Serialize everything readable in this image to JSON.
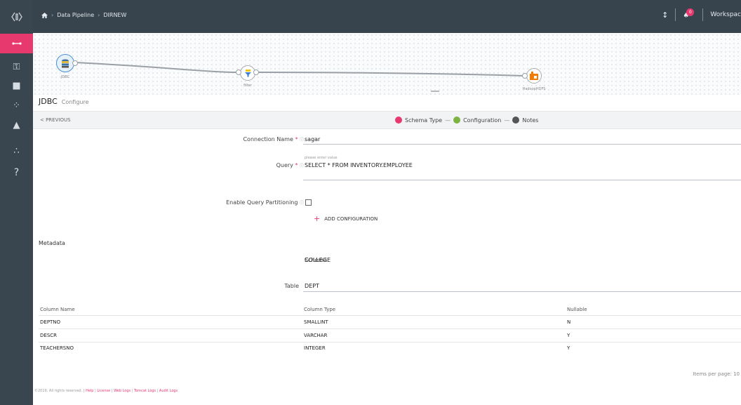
{
  "colors": {
    "accent": "#e8396f",
    "topbar": "#37444e",
    "rail": "#394650",
    "step_green": "#7cb342",
    "step_grey": "#555555",
    "hdfs_orange": "#f57c00"
  },
  "header": {
    "breadcrumb": [
      "Data Pipeline",
      "DIRNEW"
    ],
    "workspace_label": "Workspac",
    "notification_count": "0"
  },
  "pipeline": {
    "nodes": [
      {
        "label": "JDBC",
        "icon": "database-icon"
      },
      {
        "label": "filter",
        "icon": "filter-icon"
      },
      {
        "label": "HadoopHDFS",
        "icon": "hdfs-icon"
      }
    ]
  },
  "panel": {
    "title": "JDBC",
    "subtitle": "Configure"
  },
  "steps": {
    "previous_label": "< PREVIOUS",
    "items": [
      {
        "label": "Schema Type",
        "color": "#e8396f"
      },
      {
        "label": "Configuration",
        "color": "#7cb342"
      },
      {
        "label": "Notes",
        "color": "#555555"
      }
    ]
  },
  "form": {
    "connection_name": {
      "label": "Connection Name",
      "value": "sagar"
    },
    "query": {
      "label": "Query",
      "hint": "please enter value",
      "value": "SELECT * FROM INVENTORY.EMPLOYEE"
    },
    "partitioning": {
      "label": "Enable Query Partitioning",
      "checked": false
    },
    "add_configuration_label": "ADD CONFIGURATION"
  },
  "metadata": {
    "title": "Metadata",
    "schema": {
      "label": "Schema",
      "value": "COLLEGE"
    },
    "table": {
      "label": "Table",
      "value": "DEPT"
    },
    "columns": [
      "Column Name",
      "Column Type",
      "Nullable"
    ],
    "rows": [
      {
        "name": "DEPTNO",
        "type": "SMALLINT",
        "nullable": "N"
      },
      {
        "name": "DESCR",
        "type": "VARCHAR",
        "nullable": "Y"
      },
      {
        "name": "TEACHERSNO",
        "type": "INTEGER",
        "nullable": "Y"
      }
    ]
  },
  "pager": {
    "label": "Items per page: 10"
  },
  "footer": {
    "copyright": "©2019. All rights reserved.",
    "links": [
      "Help",
      "License",
      "Web Logs",
      "Tomcat Logs",
      "Audit Logs"
    ]
  }
}
